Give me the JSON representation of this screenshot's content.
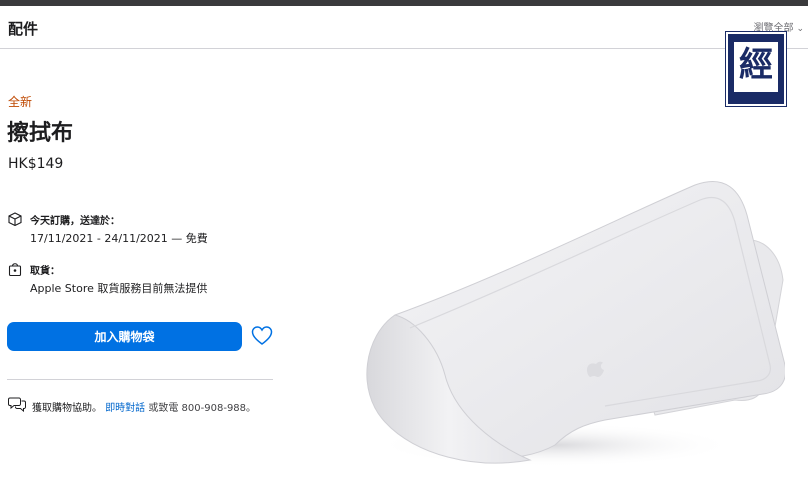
{
  "header": {
    "title": "配件",
    "link_label": "瀏覽全部"
  },
  "watermark": {
    "char": "經"
  },
  "product": {
    "new_label": "全新",
    "title": "擦拭布",
    "price": "HK$149"
  },
  "delivery": {
    "title": "今天訂購，送達於：",
    "detail": "17/11/2021 - 24/11/2021 — 免費"
  },
  "pickup": {
    "title": "取貨：",
    "detail": "Apple Store 取貨服務目前無法提供"
  },
  "actions": {
    "add_to_bag": "加入購物袋"
  },
  "help": {
    "prefix": "獲取購物協助。",
    "chat_link": "即時對話",
    "suffix": "或致電 800-908-988。"
  },
  "colors": {
    "accent": "#0071e3",
    "new_label": "#bf4800",
    "link": "#0066cc",
    "watermark": "#1a2b66"
  },
  "icons": [
    "box-icon",
    "bag-icon",
    "heart-icon",
    "chat-bubbles-icon",
    "chevron-down-icon"
  ]
}
